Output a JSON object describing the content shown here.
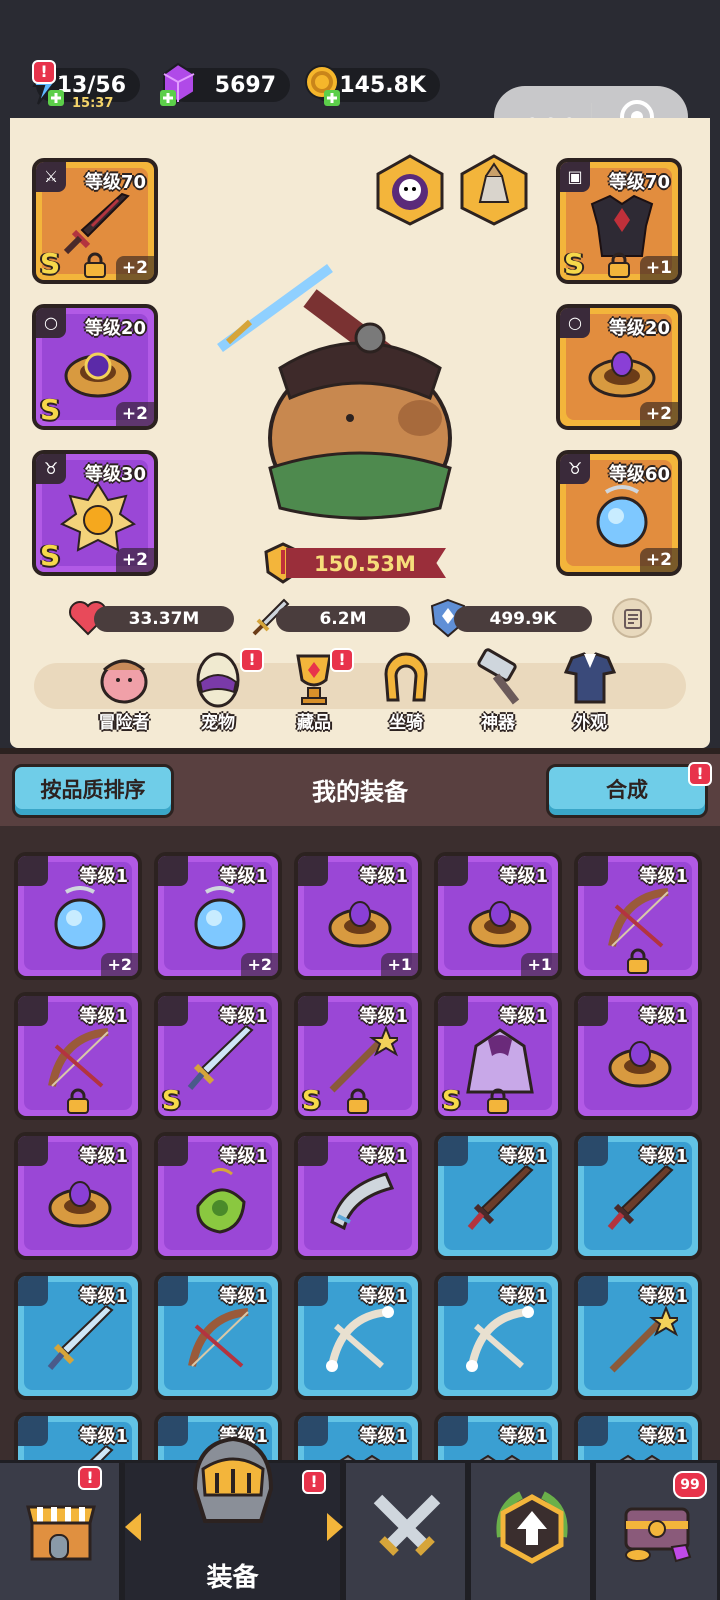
{
  "resources": {
    "energy": "13/56",
    "energy_timer": "15:37",
    "gems": "5697",
    "gold": "145.8K"
  },
  "mini_program": {
    "more_label": "•••"
  },
  "equipped": {
    "weapon": {
      "level": "等级70",
      "grade": "S",
      "plus": "+2"
    },
    "armor": {
      "level": "等级70",
      "grade": "S",
      "plus": "+1"
    },
    "ring_left": {
      "level": "等级20",
      "grade": "S",
      "plus": "+2"
    },
    "ring_right": {
      "level": "等级20",
      "plus": "+2"
    },
    "amulet_left": {
      "level": "等级30",
      "grade": "S",
      "plus": "+2"
    },
    "amulet_right": {
      "level": "等级60",
      "plus": "+2"
    }
  },
  "stats": {
    "power": "150.53M",
    "hp": "33.37M",
    "attack": "6.2M",
    "defense": "499.9K"
  },
  "nav": {
    "adventurer": "冒险者",
    "pet": "宠物",
    "collection": "藏品",
    "mount": "坐骑",
    "artifact": "神器",
    "appearance": "外观"
  },
  "equipment_header": {
    "sort_button": "按品质排序",
    "title": "我的装备",
    "merge_button": "合成",
    "alert": "!"
  },
  "inventory": [
    {
      "level": "等级1",
      "plus": "+2",
      "rarity": "purple",
      "icon": "amulet-icon"
    },
    {
      "level": "等级1",
      "plus": "+2",
      "rarity": "purple",
      "icon": "amulet-icon"
    },
    {
      "level": "等级1",
      "plus": "+1",
      "rarity": "purple",
      "icon": "ring-icon"
    },
    {
      "level": "等级1",
      "plus": "+1",
      "rarity": "purple",
      "icon": "ring-icon"
    },
    {
      "level": "等级1",
      "rarity": "purple",
      "icon": "bow-icon",
      "locked": true
    },
    {
      "level": "等级1",
      "rarity": "purple",
      "icon": "bow-icon",
      "locked": true
    },
    {
      "level": "等级1",
      "grade": "S",
      "rarity": "purple",
      "icon": "sword-icon"
    },
    {
      "level": "等级1",
      "grade": "S",
      "rarity": "purple",
      "icon": "staff-icon",
      "locked": true
    },
    {
      "level": "等级1",
      "grade": "S",
      "rarity": "purple",
      "icon": "cloak-icon",
      "locked": true
    },
    {
      "level": "等级1",
      "rarity": "purple",
      "icon": "ring-icon"
    },
    {
      "level": "等级1",
      "rarity": "purple",
      "icon": "ring-icon"
    },
    {
      "level": "等级1",
      "rarity": "purple",
      "icon": "potion-amulet-icon"
    },
    {
      "level": "等级1",
      "rarity": "purple",
      "icon": "horn-icon"
    },
    {
      "level": "等级1",
      "rarity": "blue",
      "icon": "wooden-sword-icon"
    },
    {
      "level": "等级1",
      "rarity": "blue",
      "icon": "wooden-sword-icon"
    },
    {
      "level": "等级1",
      "rarity": "blue",
      "icon": "sword-icon"
    },
    {
      "level": "等级1",
      "rarity": "blue",
      "icon": "bow-icon"
    },
    {
      "level": "等级1",
      "rarity": "blue",
      "icon": "bone-bow-icon"
    },
    {
      "level": "等级1",
      "rarity": "blue",
      "icon": "bone-bow-icon"
    },
    {
      "level": "等级1",
      "rarity": "blue",
      "icon": "staff-icon"
    },
    {
      "level": "等级1",
      "rarity": "blue",
      "icon": "sword-icon"
    },
    {
      "level": "等级1",
      "rarity": "blue",
      "icon": "armor-icon"
    },
    {
      "level": "等级1",
      "rarity": "blue",
      "icon": "armor-icon"
    },
    {
      "level": "等级1",
      "rarity": "blue",
      "icon": "armor-icon"
    },
    {
      "level": "等级1",
      "rarity": "blue",
      "icon": "armor-icon"
    }
  ],
  "bottom_nav": {
    "equipment_label": "装备",
    "chest_badge": "99",
    "alert": "!"
  },
  "colors": {
    "purple_card": "#b25ae6",
    "blue_card": "#62c3e5",
    "gold_card": "#f3b53b",
    "alert_red": "#e8334b",
    "panel_bg": "#f4ead4"
  }
}
